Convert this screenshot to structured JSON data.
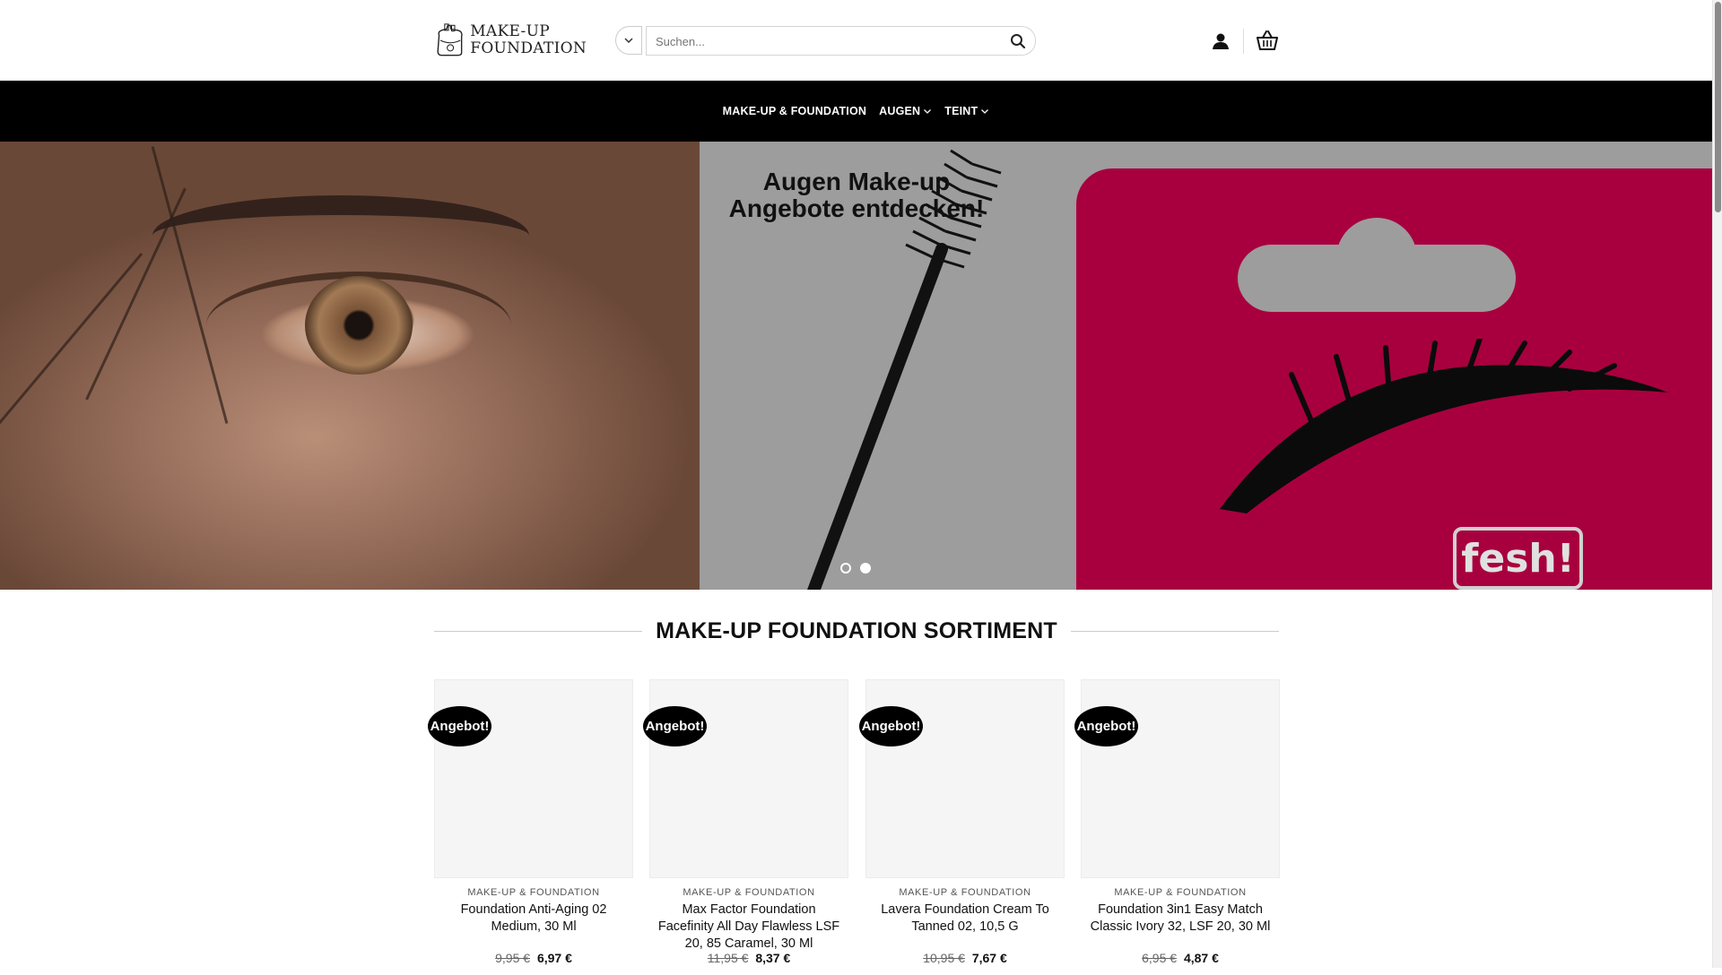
{
  "header": {
    "logo_line1": "MAKE-UP",
    "logo_line2": "FOUNDATION",
    "search_placeholder": "Suchen..."
  },
  "nav": {
    "items": [
      {
        "label": "MAKE-UP & FOUNDATION",
        "has_dropdown": false
      },
      {
        "label": "AUGEN",
        "has_dropdown": true
      },
      {
        "label": "TEINT",
        "has_dropdown": true
      }
    ]
  },
  "hero": {
    "title_line1": "Augen Make-up",
    "title_line2": "Angebote entdecken!",
    "brand_logo_text": "fesh!",
    "slides": 2,
    "active_slide": 2
  },
  "section": {
    "title": "MAKE-UP FOUNDATION SORTIMENT"
  },
  "products": [
    {
      "badge": "Angebot!",
      "category": "MAKE-UP & FOUNDATION",
      "name": "Foundation Anti-Aging 02 Medium, 30 Ml",
      "old_price": "9,95 €",
      "price": "6,97 €"
    },
    {
      "badge": "Angebot!",
      "category": "MAKE-UP & FOUNDATION",
      "name": "Max Factor Foundation Facefinity All Day Flawless LSF 20, 85 Caramel, 30 Ml",
      "old_price": "11,95 €",
      "price": "8,37 €"
    },
    {
      "badge": "Angebot!",
      "category": "MAKE-UP & FOUNDATION",
      "name": "Lavera Foundation Cream To Tanned 02, 10,5 G",
      "old_price": "10,95 €",
      "price": "7,67 €"
    },
    {
      "badge": "Angebot!",
      "category": "MAKE-UP & FOUNDATION",
      "name": "Foundation 3in1 Easy Match Classic Ivory 32, LSF 20, 30 Ml",
      "old_price": "6,95 €",
      "price": "4,87 €"
    }
  ],
  "icons": {
    "category_select": "chevron-down-icon",
    "search": "search-icon",
    "account": "user-icon",
    "cart": "basket-icon"
  },
  "colors": {
    "nav_background": "#000000",
    "badge_background": "#000000",
    "brand_pink": "#a8003e"
  }
}
